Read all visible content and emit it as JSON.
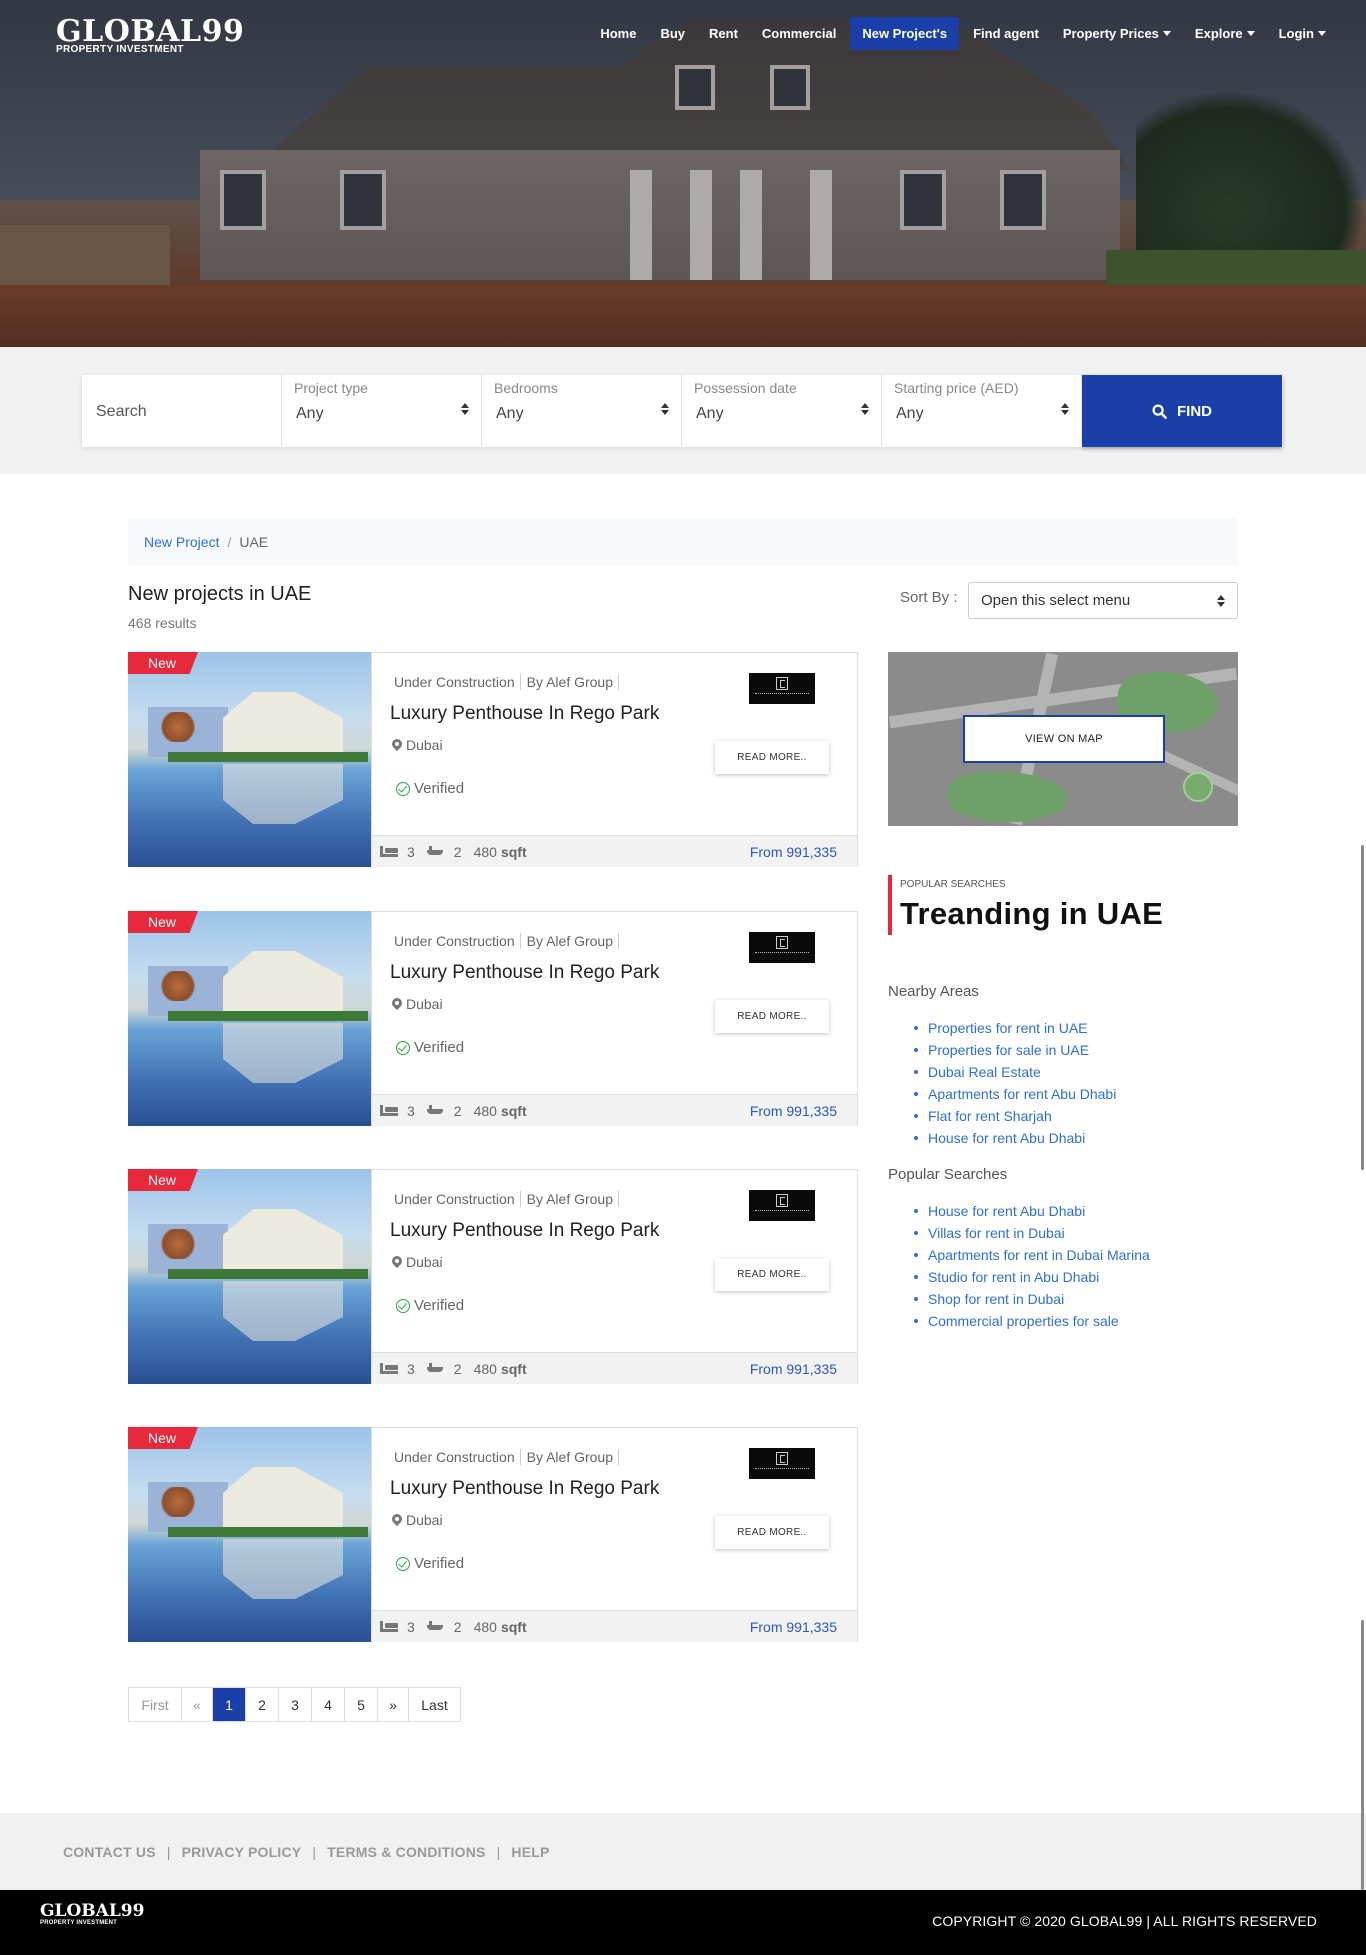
{
  "brand": {
    "name": "GLOBAL99",
    "tagline": "PROPERTY INVESTMENT"
  },
  "nav": {
    "items": [
      {
        "label": "Home",
        "dropdown": false,
        "active": false
      },
      {
        "label": "Buy",
        "dropdown": false,
        "active": false
      },
      {
        "label": "Rent",
        "dropdown": false,
        "active": false
      },
      {
        "label": "Commercial",
        "dropdown": false,
        "active": false
      },
      {
        "label": "New Project's",
        "dropdown": false,
        "active": true
      },
      {
        "label": "Find agent",
        "dropdown": false,
        "active": false
      },
      {
        "label": "Property Prices",
        "dropdown": true,
        "active": false
      },
      {
        "label": "Explore",
        "dropdown": true,
        "active": false
      },
      {
        "label": "Login",
        "dropdown": true,
        "active": false
      }
    ]
  },
  "search": {
    "placeholder": "Search",
    "fields": [
      {
        "label": "Project type",
        "value": "Any"
      },
      {
        "label": "Bedrooms",
        "value": "Any"
      },
      {
        "label": "Possession date",
        "value": "Any"
      },
      {
        "label": "Starting price (AED)",
        "value": "Any"
      }
    ],
    "find_label": "FIND"
  },
  "breadcrumb": {
    "link": "New Project",
    "separator": "/",
    "current": "UAE"
  },
  "listing": {
    "title": "New projects in UAE",
    "results": "468 results",
    "sort_label": "Sort By :",
    "sort_value": "Open this select menu"
  },
  "cards": [
    {
      "badge": "New",
      "status": "Under Construction",
      "developer": "By Alef Group",
      "name": "Luxury Penthouse In Rego Park",
      "location": "Dubai",
      "verified": "Verified",
      "read_more": "READ MORE..",
      "beds": "3",
      "baths": "2",
      "area": "480",
      "area_unit": "sqft",
      "price": "From 991,335"
    },
    {
      "badge": "New",
      "status": "Under Construction",
      "developer": "By Alef Group",
      "name": "Luxury Penthouse In Rego Park",
      "location": "Dubai",
      "verified": "Verified",
      "read_more": "READ MORE..",
      "beds": "3",
      "baths": "2",
      "area": "480",
      "area_unit": "sqft",
      "price": "From 991,335"
    },
    {
      "badge": "New",
      "status": "Under Construction",
      "developer": "By Alef Group",
      "name": "Luxury Penthouse In Rego Park",
      "location": "Dubai",
      "verified": "Verified",
      "read_more": "READ MORE..",
      "beds": "3",
      "baths": "2",
      "area": "480",
      "area_unit": "sqft",
      "price": "From 991,335"
    },
    {
      "badge": "New",
      "status": "Under Construction",
      "developer": "By Alef Group",
      "name": "Luxury Penthouse In Rego Park",
      "location": "Dubai",
      "verified": "Verified",
      "read_more": "READ MORE..",
      "beds": "3",
      "baths": "2",
      "area": "480",
      "area_unit": "sqft",
      "price": "From 991,335"
    }
  ],
  "sidebar": {
    "map_button": "VIEW ON MAP",
    "kicker": "POPULAR SEARCHES",
    "heading": "Treanding in UAE",
    "nearby_title": "Nearby Areas",
    "nearby": [
      "Properties for rent in UAE",
      "Properties for sale in UAE",
      "Dubai Real Estate",
      "Apartments for rent Abu Dhabi",
      "Flat for rent Sharjah",
      "House for rent Abu Dhabi"
    ],
    "popular_title": "Popular Searches",
    "popular": [
      "House for rent Abu Dhabi",
      "Villas for rent in Dubai",
      "Apartments for rent in Dubai Marina",
      "Studio for rent in Abu Dhabi",
      "Shop for rent in Dubai",
      "Commercial properties for sale"
    ]
  },
  "pagination": {
    "first": "First",
    "prev": "«",
    "pages": [
      "1",
      "2",
      "3",
      "4",
      "5"
    ],
    "current": "1",
    "next": "»",
    "last": "Last"
  },
  "footer": {
    "links": [
      "CONTACT US",
      "PRIVACY POLICY",
      "TERMS & CONDITIONS",
      "HELP"
    ],
    "link_separator": "|",
    "copyright": "COPYRIGHT © 2020 GLOBAL99 | ALL RIGHTS RESERVED"
  },
  "colors": {
    "primary": "#1b3fa8",
    "accent_red": "#e8283c",
    "link": "#2e6fd6",
    "price": "#2856c4",
    "verified": "#2aa845"
  }
}
